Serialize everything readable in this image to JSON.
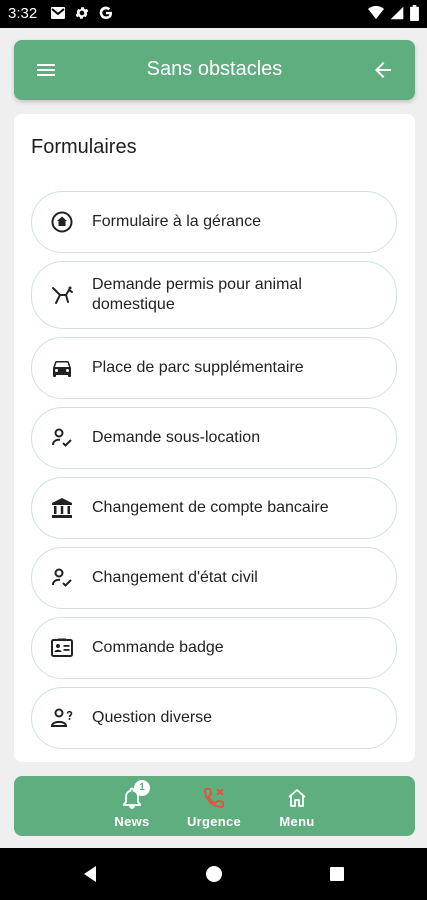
{
  "status_bar": {
    "time": "3:32",
    "left_icons": [
      "gmail-icon",
      "gear-icon",
      "google-icon"
    ],
    "right_icons": [
      "wifi-icon",
      "signal-icon",
      "battery-icon"
    ]
  },
  "app_bar": {
    "title": "Sans obstacles",
    "menu_icon": "hamburger-menu-icon",
    "back_icon": "arrow-back-icon"
  },
  "section": {
    "title": "Formulaires"
  },
  "forms": [
    {
      "label": "Formulaire à la gérance",
      "icon": "home-circle-icon"
    },
    {
      "label": "Demande permis pour animal domestique",
      "icon": "pet-icon"
    },
    {
      "label": "Place de parc supplémentaire",
      "icon": "car-icon"
    },
    {
      "label": "Demande sous-location",
      "icon": "person-check-icon"
    },
    {
      "label": "Changement de compte bancaire",
      "icon": "bank-icon"
    },
    {
      "label": "Changement d'état civil",
      "icon": "person-check-icon"
    },
    {
      "label": "Commande badge",
      "icon": "id-badge-icon"
    },
    {
      "label": "Question diverse",
      "icon": "person-question-icon"
    }
  ],
  "bottom_nav": {
    "news": {
      "label": "News",
      "badge": "1",
      "icon": "bell-icon"
    },
    "urgence": {
      "label": "Urgence",
      "icon": "phone-alert-icon",
      "color": "#e5533c"
    },
    "menu": {
      "label": "Menu",
      "icon": "home-icon"
    }
  },
  "colors": {
    "accent": "#5fae80",
    "item_border": "#cfe4d6",
    "urgence": "#e5533c"
  }
}
